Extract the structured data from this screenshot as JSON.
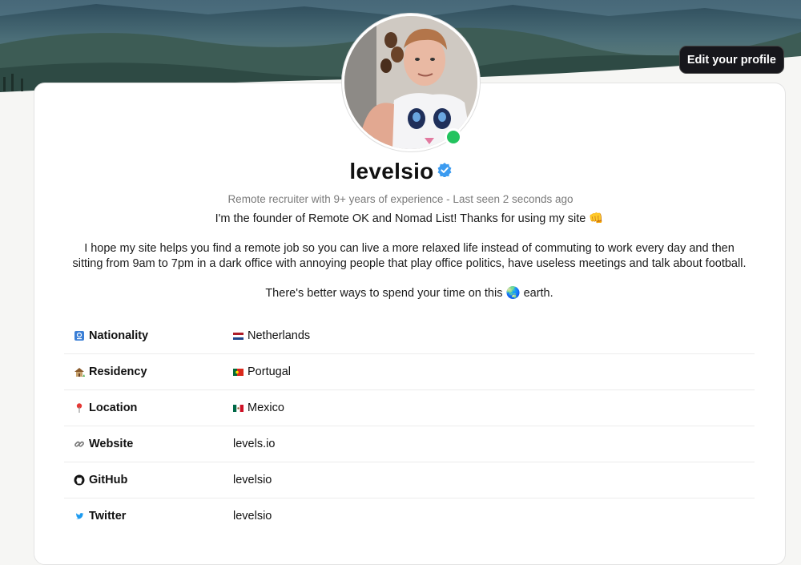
{
  "header": {
    "edit_profile_label": "Edit your profile"
  },
  "profile": {
    "username": "levelsio",
    "subtitle": "Remote recruiter with 9+ years of experience - Last seen 2 seconds ago",
    "bio": [
      "I'm the founder of Remote OK and Nomad List! Thanks for using my site 👊",
      "I hope my site helps you find a remote job so you can live a more relaxed life instead of commuting to work every day and then sitting from 9am to 7pm in a dark office with annoying people that play office politics, have useless meetings and talk about football.",
      "There's better ways to spend your time on this 🌏 earth."
    ],
    "status": "online",
    "status_color": "#22c35e",
    "verified_color": "#3b9bf0"
  },
  "details": [
    {
      "icon": "passport-icon",
      "label": "Nationality",
      "value_icon": "netherlands-flag-icon",
      "value": "Netherlands"
    },
    {
      "icon": "house-icon",
      "label": "Residency",
      "value_icon": "portugal-flag-icon",
      "value": "Portugal"
    },
    {
      "icon": "pin-icon",
      "label": "Location",
      "value_icon": "mexico-flag-icon",
      "value": "Mexico"
    },
    {
      "icon": "link-icon",
      "label": "Website",
      "value": "levels.io"
    },
    {
      "icon": "github-icon",
      "label": "GitHub",
      "value": "levelsio"
    },
    {
      "icon": "twitter-icon",
      "label": "Twitter",
      "value": "levelsio"
    }
  ]
}
